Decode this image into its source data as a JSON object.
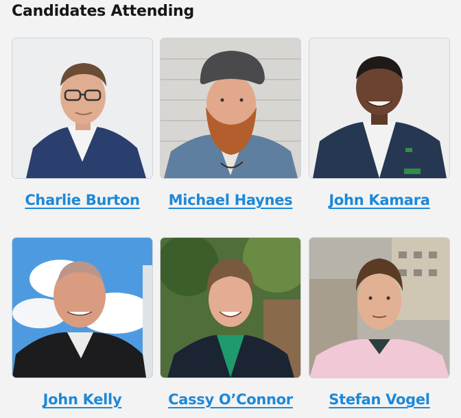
{
  "heading": "Candidates Attending",
  "candidates": [
    {
      "name": "Charlie Burton"
    },
    {
      "name": "Michael Haynes"
    },
    {
      "name": "John Kamara"
    },
    {
      "name": "John Kelly"
    },
    {
      "name": "Cassy O’Connor"
    },
    {
      "name": "Stefan Vogel"
    }
  ]
}
